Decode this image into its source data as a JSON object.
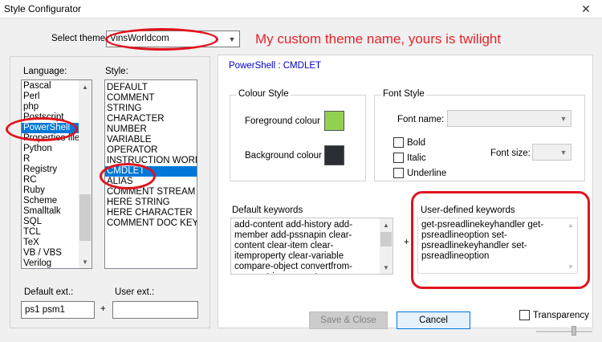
{
  "window": {
    "title": "Style Configurator",
    "close_glyph": "✕"
  },
  "theme": {
    "label": "Select theme:",
    "value": "VinsWorldcom"
  },
  "annotation": "My custom theme name, yours is twilight",
  "language": {
    "label": "Language:",
    "items": [
      "Pascal",
      "Perl",
      "php",
      "Postscript",
      "PowerShell",
      "Properties file",
      "Python",
      "R",
      "Registry",
      "RC",
      "Ruby",
      "Scheme",
      "Smalltalk",
      "SQL",
      "TCL",
      "TeX",
      "VB / VBS",
      "Verilog"
    ],
    "selected": "PowerShell"
  },
  "style": {
    "label": "Style:",
    "items": [
      "DEFAULT",
      "COMMENT",
      "STRING",
      "CHARACTER",
      "NUMBER",
      "VARIABLE",
      "OPERATOR",
      "INSTRUCTION WORD",
      "CMDLET",
      "ALIAS",
      "COMMENT STREAM",
      "HERE STRING",
      "HERE CHARACTER",
      "COMMENT DOC KEYWORD"
    ],
    "selected": "CMDLET"
  },
  "ext": {
    "default_label": "Default ext.:",
    "default_value": "ps1 psm1",
    "plus": "+",
    "user_label": "User ext.:",
    "user_value": ""
  },
  "header": "PowerShell : CMDLET",
  "colour_style": {
    "title": "Colour Style",
    "fg_label": "Foreground colour",
    "fg_color": "#92d050",
    "bg_label": "Background colour",
    "bg_color": "#2b2f33"
  },
  "font_style": {
    "title": "Font Style",
    "name_label": "Font name:",
    "bold": "Bold",
    "italic": "Italic",
    "underline": "Underline",
    "size_label": "Font size:"
  },
  "keywords": {
    "default_title": "Default keywords",
    "default_text": "add-content add-history add-member add-pssnapin clear-content clear-item clear-itemproperty clear-variable compare-object convertfrom-securestring convert-",
    "plus": "+",
    "user_title": "User-defined keywords",
    "user_text": "get-psreadlinekeyhandler get-psreadlineoption set-psreadlinekeyhandler set-psreadlineoption"
  },
  "buttons": {
    "save": "Save & Close",
    "cancel": "Cancel"
  },
  "transparency": {
    "label": "Transparency"
  },
  "colors": {
    "accent": "#0078d7",
    "annotation": "#e8222a",
    "header_text": "#0000cc"
  }
}
